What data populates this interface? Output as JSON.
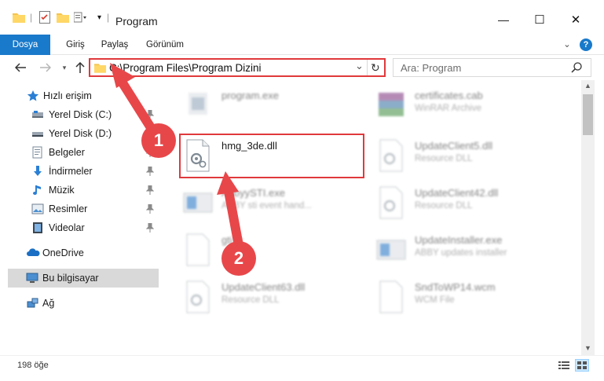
{
  "window": {
    "title": "Program",
    "minimize_glyph": "—",
    "maximize_glyph": "☐",
    "close_glyph": "✕"
  },
  "ribbon": {
    "tabs": [
      "Dosya",
      "Giriş",
      "Paylaş",
      "Görünüm"
    ],
    "expand_glyph": "⌄",
    "help_glyph": "?"
  },
  "address": {
    "path": "C:\\Program Files\\Program Dizini",
    "dropdown_glyph": "⌄",
    "refresh_glyph": "↻"
  },
  "search": {
    "placeholder": "Ara: Program",
    "icon": "search-icon"
  },
  "sidebar": {
    "items": [
      {
        "label": "Hızlı erişim",
        "icon": "star-icon"
      },
      {
        "label": "Yerel Disk (C:)",
        "icon": "drive-icon"
      },
      {
        "label": "Yerel Disk (D:)",
        "icon": "drive-icon"
      },
      {
        "label": "Belgeler",
        "icon": "documents-icon"
      },
      {
        "label": "İndirmeler",
        "icon": "download-icon"
      },
      {
        "label": "Müzik",
        "icon": "music-icon"
      },
      {
        "label": "Resimler",
        "icon": "pictures-icon"
      },
      {
        "label": "Videolar",
        "icon": "video-icon"
      },
      {
        "label": "OneDrive",
        "icon": "cloud-icon"
      },
      {
        "label": "Bu bilgisayar",
        "icon": "computer-icon"
      },
      {
        "label": "Ağ",
        "icon": "network-icon"
      }
    ]
  },
  "files": [
    {
      "name": "program.exe",
      "desc": "",
      "icon": "exe-icon"
    },
    {
      "name": "certificates.cab",
      "desc": "WinRAR Archive",
      "icon": "archive-icon"
    },
    {
      "name": "hmg_3de.dll",
      "desc": "",
      "icon": "dll-icon"
    },
    {
      "name": "UpdateClient5.dll",
      "desc": "Resource DLL",
      "icon": "dll-icon"
    },
    {
      "name": "AbbyySTI.exe",
      "desc": "ABBY sti event hand...",
      "icon": "exe-icon"
    },
    {
      "name": "UpdateClient42.dll",
      "desc": "Resource DLL",
      "icon": "dll-icon"
    },
    {
      "name": "gti.tk",
      "desc": "",
      "icon": "file-icon"
    },
    {
      "name": "UpdateInstaller.exe",
      "desc": "ABBY updates installer",
      "icon": "exe-icon"
    },
    {
      "name": "UpdateClient63.dll",
      "desc": "Resource DLL",
      "icon": "dll-icon"
    },
    {
      "name": "SndToWP14.wcm",
      "desc": "WCM File",
      "icon": "file-icon"
    }
  ],
  "status": {
    "item_count": "198 öğe"
  },
  "annotations": {
    "step1": "1",
    "step2": "2",
    "accent": "#e0393b"
  }
}
